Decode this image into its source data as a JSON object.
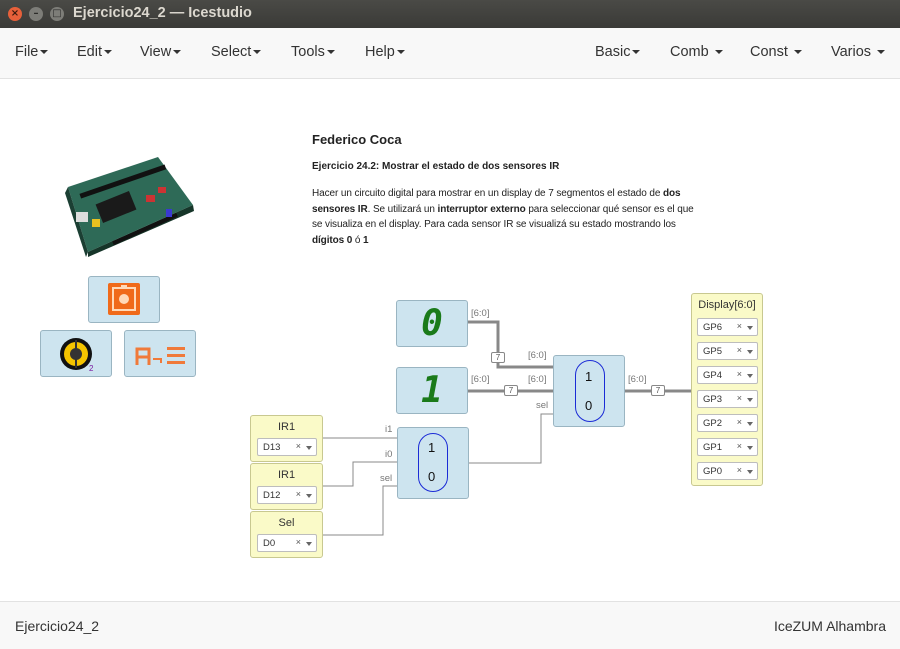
{
  "window": {
    "title": "Ejercicio24_2 — Icestudio"
  },
  "menus_left": [
    "File",
    "Edit",
    "View",
    "Select",
    "Tools",
    "Help"
  ],
  "menus_right": [
    "Basic",
    "Comb",
    "Const",
    "Varios"
  ],
  "info": {
    "author": "Federico Coca",
    "subtitle": "Ejercicio 24.2: Mostrar el estado de dos sensores IR",
    "desc_1": "Hacer un circuito digital para mostrar en un display de 7 segmentos el estado de ",
    "desc_b1": "dos sensores IR",
    "desc_2": ". Se utilizará un ",
    "desc_b2": "interruptor externo",
    "desc_3": " para seleccionar qué sensor es el que se visualiza en el display. Para cada sensor IR se visualizá su estado mostrando los ",
    "desc_b3": "dígitos 0",
    "desc_4": " ó ",
    "desc_b4": "1"
  },
  "blocks": {
    "digit_top": "0",
    "digit_bottom": "1",
    "mux_top": "1",
    "mux_bottom": "0",
    "mux2_top": "1",
    "mux2_bottom": "0",
    "ir1_a": {
      "name": "IR1",
      "pin": "D13"
    },
    "ir1_b": {
      "name": "IR1",
      "pin": "D12"
    },
    "sel": {
      "name": "Sel",
      "pin": "D0"
    },
    "display_title": "Display[6:0]",
    "gp": [
      "GP6",
      "GP5",
      "GP4",
      "GP3",
      "GP2",
      "GP1",
      "GP0"
    ],
    "clear_glyph": "×",
    "ir_subscript": "2"
  },
  "labels": {
    "bus_a": "[6:0]",
    "bus_b": "[6:0]",
    "bus_c": "[6:0]",
    "bus_d": "[6:0]",
    "bus_out": "[6:0]",
    "width": "7",
    "i1": "i1",
    "i0": "i0",
    "sel_in": "sel",
    "sel_in2": "sel"
  },
  "footer": {
    "left": "Ejercicio24_2",
    "right": "IceZUM Alhambra"
  },
  "colors": {
    "block_fill": "#cde4ef",
    "input_fill": "#fafac8",
    "mux_border": "#1b2bd6",
    "segment": "#1a7a1a",
    "wire": "#888888"
  }
}
